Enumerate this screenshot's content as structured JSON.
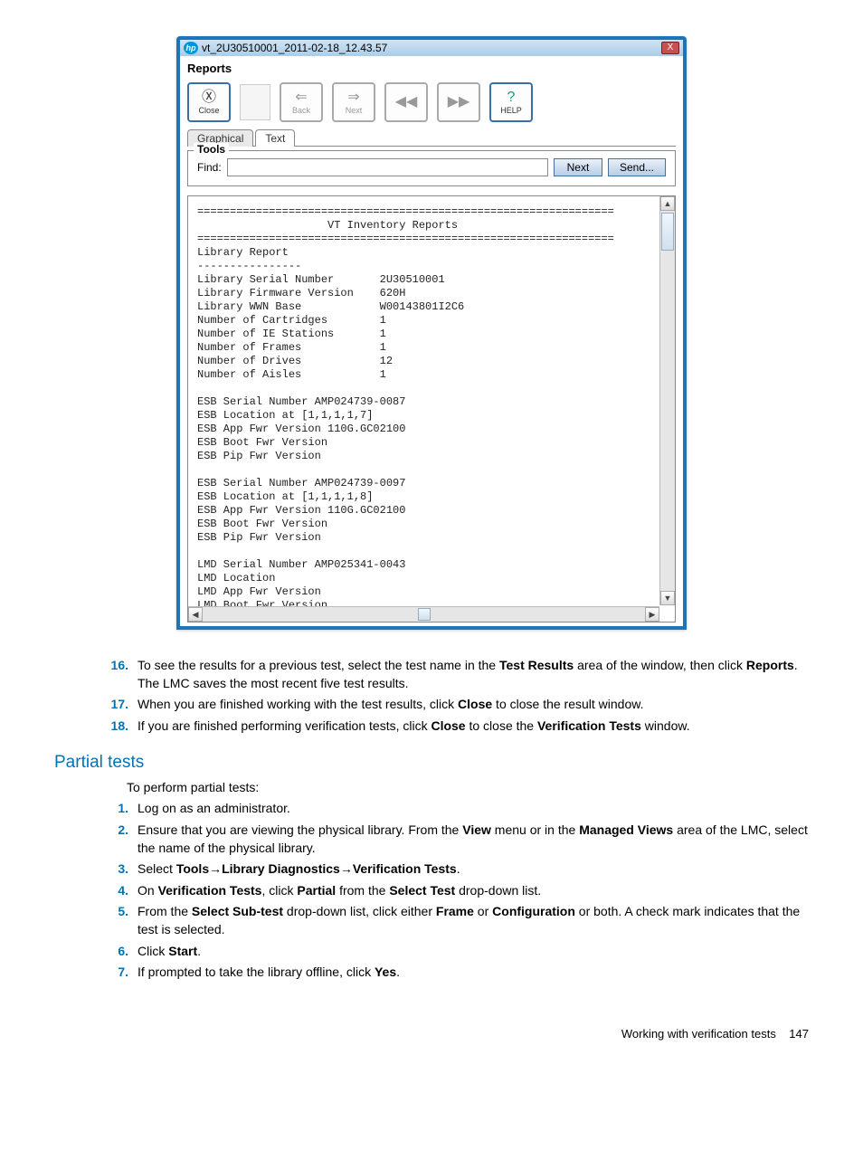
{
  "window": {
    "title": "vt_2U30510001_2011-02-18_12.43.57",
    "section_label": "Reports",
    "hp_logo_text": "hp",
    "close_x": "X",
    "toolbar": {
      "close": "Close",
      "back": "Back",
      "next": "Next",
      "help": "HELP",
      "rewind": "◀◀",
      "forward": "▶▶",
      "close_icon": "Ⓧ",
      "back_icon": "⇐",
      "next_icon": "⇒",
      "help_icon": "?"
    },
    "tabs": {
      "graphical": "Graphical",
      "text": "Text"
    },
    "tools_legend": "Tools",
    "find_label": "Find:",
    "find_value": "",
    "find_next": "Next",
    "send": "Send...",
    "report_text": "================================================================\n                    VT Inventory Reports\n================================================================\nLibrary Report\n----------------\nLibrary Serial Number       2U30510001\nLibrary Firmware Version    620H\nLibrary WWN Base            W00143801I2C6\nNumber of Cartridges        1\nNumber of IE Stations       1\nNumber of Frames            1\nNumber of Drives            12\nNumber of Aisles            1\n\nESB Serial Number AMP024739-0087\nESB Location at [1,1,1,1,7]\nESB App Fwr Version 110G.GC02100\nESB Boot Fwr Version\nESB Pip Fwr Version\n\nESB Serial Number AMP024739-0097\nESB Location at [1,1,1,1,8]\nESB App Fwr Version 110G.GC02100\nESB Boot Fwr Version\nESB Pip Fwr Version\n\nLMD Serial Number AMP025341-0043\nLMD Location\nLMD App Fwr Version\nLMD Boot Fwr Version"
  },
  "steps_a": [
    {
      "n": "16.",
      "html": "To see the results for a previous test, select the test name in the <b>Test Results</b> area of the window, then click <b>Reports</b>. The LMC saves the most recent five test results."
    },
    {
      "n": "17.",
      "html": "When you are finished working with the test results, click <b>Close</b> to close the result window."
    },
    {
      "n": "18.",
      "html": "If you are finished performing verification tests, click <b>Close</b> to close the <b>Verification Tests</b> window."
    }
  ],
  "partial_heading": "Partial tests",
  "partial_intro": "To perform partial tests:",
  "steps_b": [
    {
      "n": "1.",
      "html": "Log on as an administrator."
    },
    {
      "n": "2.",
      "html": "Ensure that you are viewing the physical library. From the <b>View</b> menu or in the <b>Managed Views</b> area of the LMC, select the name of the physical library."
    },
    {
      "n": "3.",
      "html": "Select <b>Tools</b>→<b>Library Diagnostics</b>→<b>Verification Tests</b>."
    },
    {
      "n": "4.",
      "html": "On <b>Verification Tests</b>, click <b>Partial</b> from the <b>Select Test</b> drop-down list."
    },
    {
      "n": "5.",
      "html": "From the <b>Select Sub-test</b> drop-down list, click either <b>Frame</b> or <b>Configuration</b> or both. A check mark indicates that the test is selected."
    },
    {
      "n": "6.",
      "html": "Click <b>Start</b>."
    },
    {
      "n": "7.",
      "html": "If prompted to take the library offline, click <b>Yes</b>."
    }
  ],
  "footer": {
    "text": "Working with verification tests",
    "page": "147"
  }
}
